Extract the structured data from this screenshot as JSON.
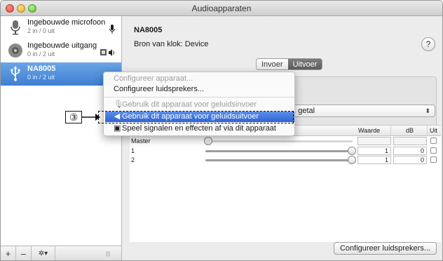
{
  "window": {
    "title": "Audioapparaten"
  },
  "sidebar": {
    "devices": [
      {
        "name": "Ingebouwde microfoon",
        "channels": "2 in / 0 uit",
        "icon": "microphone-icon"
      },
      {
        "name": "Ingebouwde uitgang",
        "channels": "0 in / 2 uit",
        "icon": "speaker-icon"
      },
      {
        "name": "NA8005",
        "channels": "0 in / 2 uit",
        "icon": "usb-icon",
        "selected": true
      }
    ],
    "toolbar": {
      "add": "+",
      "remove": "–",
      "gear": "✲▾",
      "resize": "|||"
    }
  },
  "main": {
    "device_title": "NA8005",
    "clock_label": "Bron van klok: Device",
    "help": "?",
    "tabs": [
      {
        "label": "Invoer",
        "active": false
      },
      {
        "label": "Uitvoer",
        "active": true
      }
    ],
    "format_value_partial": "h. getal",
    "table": {
      "headers": [
        "Waarde",
        "dB",
        "Uit"
      ],
      "rows": [
        {
          "label": "Master",
          "value": "",
          "db": "",
          "slider": 0.0
        },
        {
          "label": "1",
          "value": "1",
          "db": "0",
          "slider": 1.0
        },
        {
          "label": "2",
          "value": "1",
          "db": "0",
          "slider": 1.0
        }
      ]
    },
    "configure_speakers_button": "Configureer luidsprekers..."
  },
  "context_menu": {
    "items": [
      {
        "label": "Configureer apparaat...",
        "state": "disabled"
      },
      {
        "label": "Configureer luidsprekers...",
        "state": "enabled"
      },
      {
        "label": "Gebruik dit apparaat voor geluidsinvoer",
        "state": "disabled",
        "icon": "microphone-icon"
      },
      {
        "label": "Gebruik dit apparaat voor geluidsuitvoer",
        "state": "highlighted",
        "icon": "speaker-icon"
      },
      {
        "label": "Speel signalen en effecten af via dit apparaat",
        "state": "enabled",
        "icon": "alert-speaker-icon"
      }
    ]
  },
  "annotation": {
    "callout": "③"
  },
  "colors": {
    "selection": "#3f7fd1",
    "menu_highlight": "#2d63d4"
  }
}
